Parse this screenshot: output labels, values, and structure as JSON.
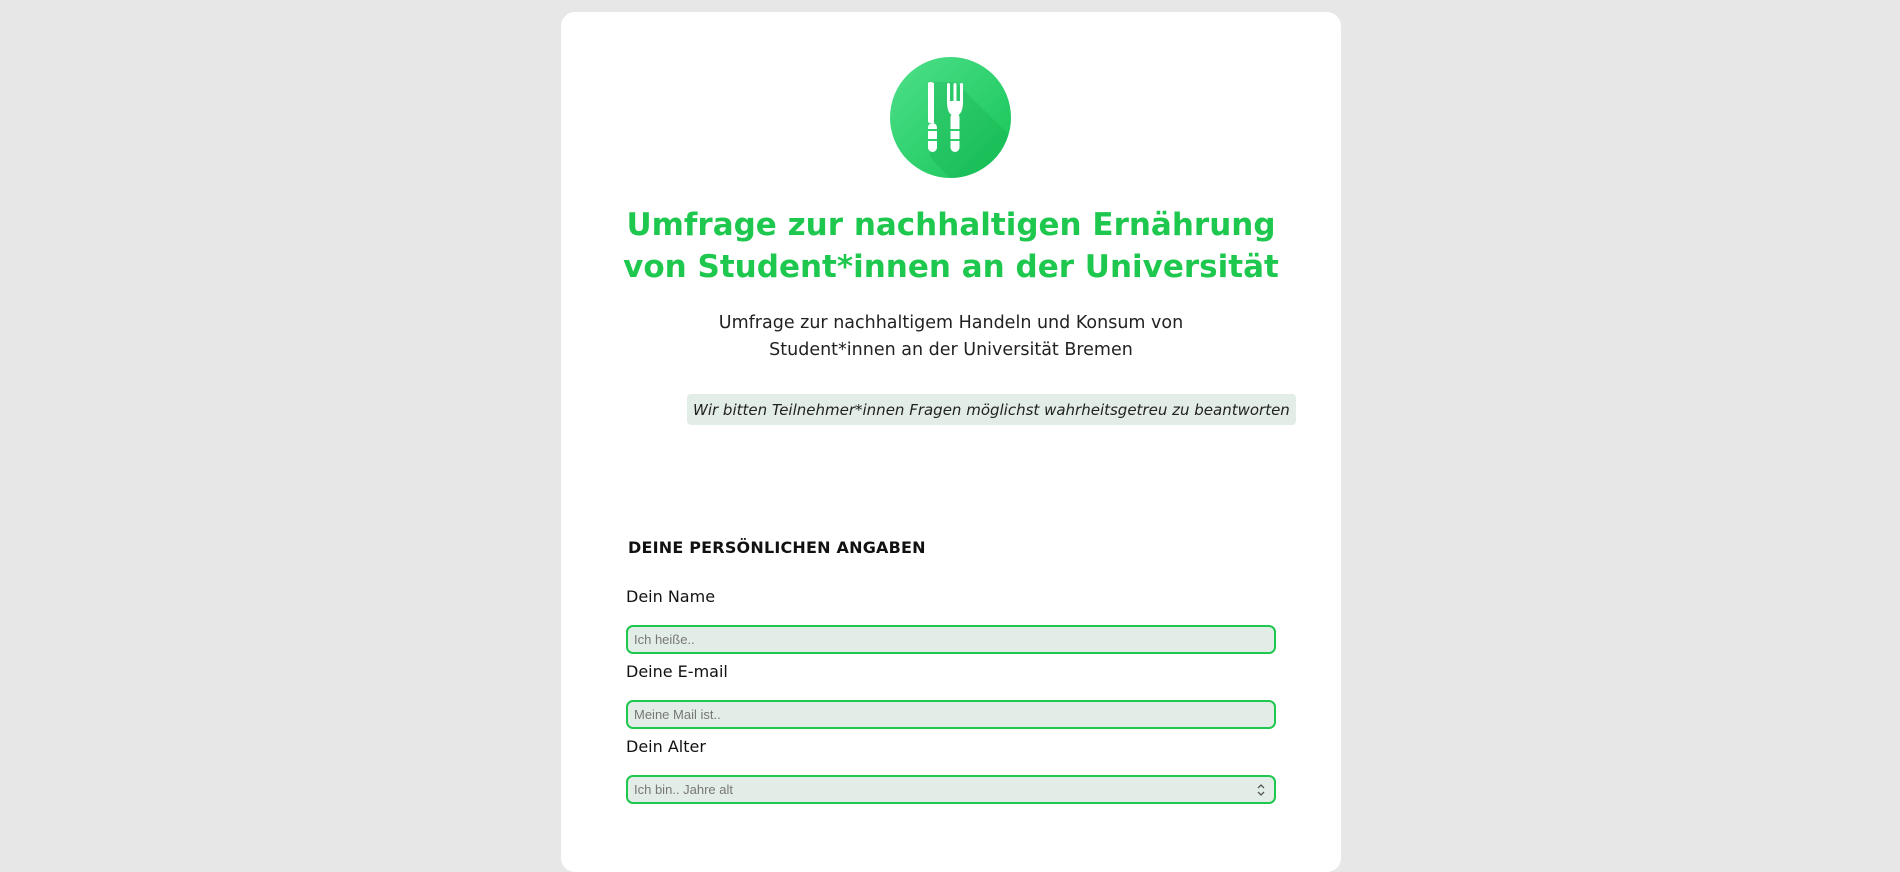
{
  "header": {
    "logo_icon": "knife-fork-icon",
    "title": "Umfrage zur nachhaltigen Ernährung von Student*innen an der Universität",
    "subtitle": "Umfrage zur nachhaltigem Handeln und Konsum von Student*innen an der Universität Bremen",
    "note": "Wir bitten Teilnehmer*innen Fragen möglichst wahrheitsgetreu zu beantworten"
  },
  "personal_section": {
    "heading": "DEINE PERSÖNLICHEN ANGABEN",
    "name": {
      "label": "Dein Name",
      "placeholder": "Ich heiße.."
    },
    "email": {
      "label": "Deine E-mail",
      "placeholder": "Meine Mail ist.."
    },
    "age": {
      "label": "Dein Alter",
      "placeholder": "Ich bin.. Jahre alt",
      "control_icon": "number-spinner-icon"
    }
  },
  "colors": {
    "accent": "#1ec84e",
    "input_background": "#e3ede7",
    "page_background": "#e7e7e7",
    "card_background": "#ffffff"
  }
}
